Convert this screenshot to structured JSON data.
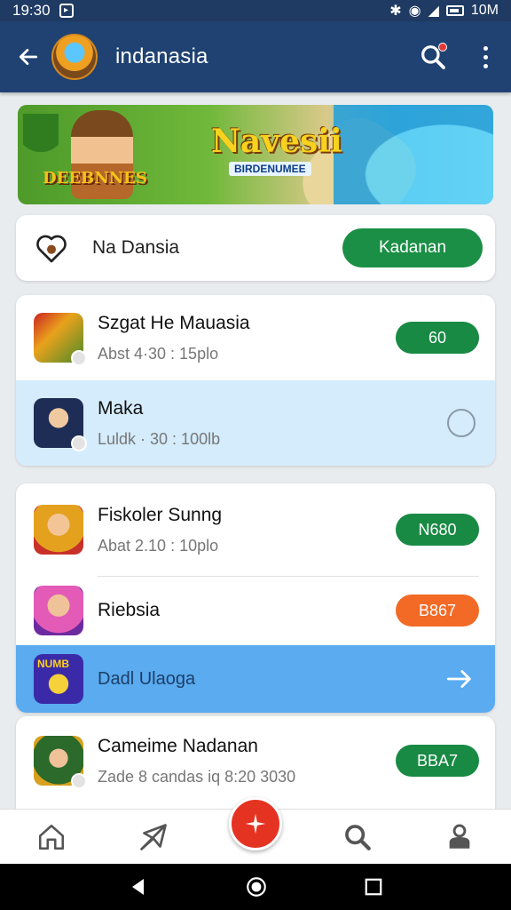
{
  "status_bar": {
    "time": "19:30",
    "right_text": "10M"
  },
  "app_bar": {
    "title": "indanasia"
  },
  "banner": {
    "title": "Navesii",
    "subtitle": "BIRDENUMEE",
    "tag": "DEEBNNES"
  },
  "header_card": {
    "label": "Na Dansia",
    "button_label": "Kadanan"
  },
  "groups": [
    {
      "items": [
        {
          "title": "Szgat He Mauasia",
          "subtitle": "Abst 4·30 : 15plo",
          "badge": "60",
          "badge_color": "#188a43"
        },
        {
          "title": "Maka",
          "subtitle": "Luldk ·  30 : 100lb",
          "state": "selected-radio"
        }
      ]
    },
    {
      "items": [
        {
          "title": "Fiskoler Sunng",
          "subtitle": "Abat 2.10 : 10plo",
          "badge": "N680",
          "badge_color": "#188a43"
        },
        {
          "title": "Riebsia",
          "badge": "B867",
          "badge_color": "#f26a25"
        },
        {
          "title": "Dadl Ulaoga",
          "state": "highlighted-arrow",
          "thumb_text": "NUMB"
        }
      ]
    },
    {
      "items": [
        {
          "title": "Cameime Nadanan",
          "subtitle": "Zade 8 candas iq  8:20 3030",
          "badge": "BBA7",
          "badge_color": "#188a43"
        }
      ]
    }
  ],
  "bottom_nav": {
    "items": [
      "home-icon",
      "plane-icon",
      "search-icon",
      "profile-icon"
    ],
    "fab_icon": "add-icon"
  },
  "colors": {
    "app_bar": "#1f4272",
    "accent_green": "#188a43",
    "accent_orange": "#f26a25",
    "highlight_blue": "#5aabf0",
    "fab": "#e53322"
  }
}
